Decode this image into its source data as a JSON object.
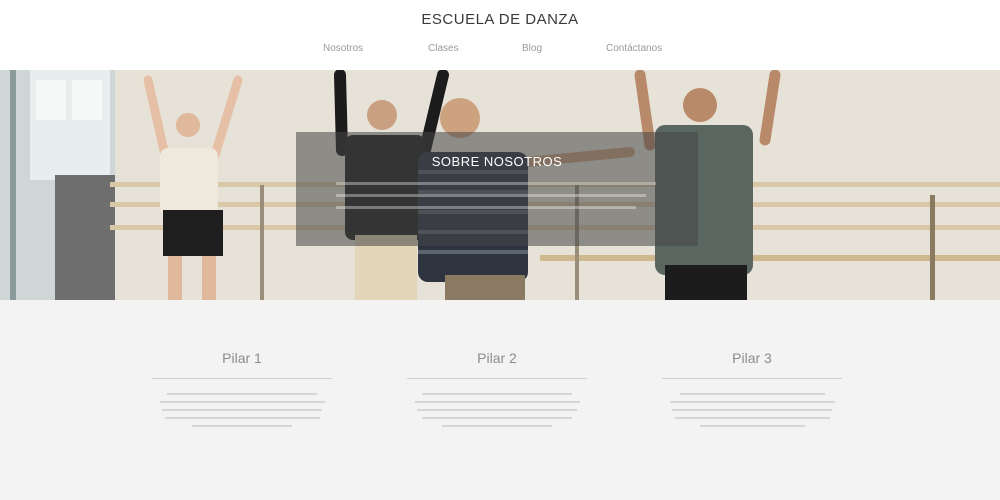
{
  "header": {
    "brand": "ESCUELA DE DANZA",
    "nav": [
      {
        "label": "Nosotros"
      },
      {
        "label": "Clases"
      },
      {
        "label": "Blog"
      },
      {
        "label": "Contáctanos"
      }
    ]
  },
  "hero": {
    "about_title": "SOBRE NOSOTROS"
  },
  "pillars": [
    {
      "title": "Pilar 1"
    },
    {
      "title": "Pilar 2"
    },
    {
      "title": "Pilar 3"
    }
  ],
  "colors": {
    "header_bg": "#ffffff",
    "page_bg": "#f3f3f3",
    "overlay": "#464646"
  }
}
